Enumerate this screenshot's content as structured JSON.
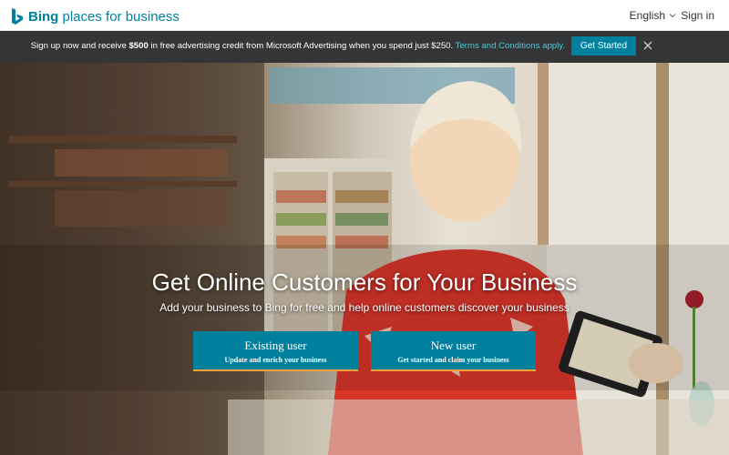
{
  "header": {
    "logo_brand": "Bing",
    "logo_rest": "places for business",
    "language": "English",
    "signin": "Sign in"
  },
  "promo": {
    "text_before": "Sign up now and receive ",
    "amount": "$500",
    "text_after": " in free advertising credit from Microsoft Advertising when you spend just $250. ",
    "terms_link": "Terms and Conditions apply.",
    "button": "Get Started"
  },
  "hero": {
    "title": "Get Online Customers for Your Business",
    "subtitle": "Add your business to Bing for free and help online customers discover your business",
    "existing": {
      "title": "Existing user",
      "subtitle": "Update and enrich your business"
    },
    "new_user": {
      "title": "New user",
      "subtitle": "Get started and claim your business"
    }
  },
  "colors": {
    "brand": "#00809d",
    "promo_bg": "#333536",
    "accent_underline": "#f2a33a",
    "link": "#53c7d6"
  },
  "icons": {
    "logo": "bing-logo-icon",
    "language_caret": "chevron-down-icon",
    "close": "close-icon"
  }
}
